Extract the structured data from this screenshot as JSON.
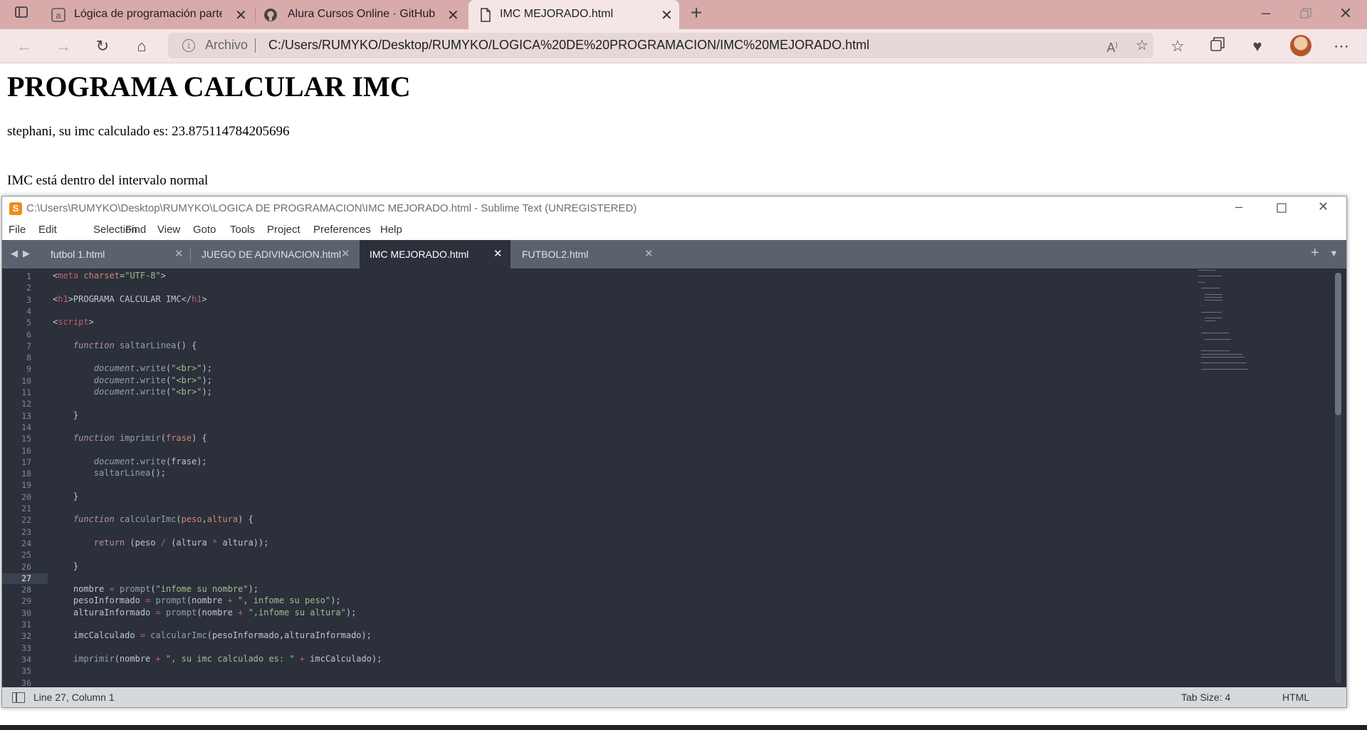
{
  "browser": {
    "tabs": [
      {
        "title": "Lógica de programación parte 2:",
        "icon": "alura-a-icon",
        "active": false
      },
      {
        "title": "Alura Cursos Online · GitHub",
        "icon": "github-icon",
        "active": false
      },
      {
        "title": "IMC MEJORADO.html",
        "icon": "document-icon",
        "active": true
      }
    ],
    "new_tab": "+",
    "omnibox": {
      "scheme_label": "Archivo",
      "url": "C:/Users/RUMYKO/Desktop/RUMYKO/LOGICA%20DE%20PROGRAMACION/IMC%20MEJORADO.html"
    }
  },
  "page": {
    "heading": "PROGRAMA CALCULAR IMC",
    "result_line": "stephani, su imc calculado es: 23.875114784205696",
    "status_line": "IMC está dentro del intervalo normal"
  },
  "sublime": {
    "title": "C:\\Users\\RUMYKO\\Desktop\\RUMYKO\\LOGICA DE PROGRAMACION\\IMC MEJORADO.html - Sublime Text (UNREGISTERED)",
    "menu": [
      "File",
      "Edit",
      "Selection",
      "Find",
      "View",
      "Goto",
      "Tools",
      "Project",
      "Preferences",
      "Help"
    ],
    "tabs": [
      {
        "label": "futbol 1.html",
        "active": false
      },
      {
        "label": "JUEGO DE ADIVINACION.html",
        "active": false
      },
      {
        "label": "IMC MEJORADO.html",
        "active": true
      },
      {
        "label": "FUTBOL2.html",
        "active": false
      }
    ],
    "current_line": 27,
    "line_numbers": [
      "1",
      "2",
      "3",
      "4",
      "5",
      "6",
      "7",
      "8",
      "9",
      "10",
      "11",
      "12",
      "13",
      "14",
      "15",
      "16",
      "17",
      "18",
      "19",
      "20",
      "21",
      "22",
      "23",
      "24",
      "25",
      "26",
      "27",
      "28",
      "29",
      "30",
      "31",
      "32",
      "33",
      "34",
      "35",
      "36"
    ],
    "code": [
      "<meta charset=\"UTF-8\">",
      "",
      "<h1>PROGRAMA CALCULAR IMC</h1>",
      "",
      "<script>",
      "",
      "    function saltarLinea() {",
      "",
      "        document.write(\"<br>\");",
      "        document.write(\"<br>\");",
      "        document.write(\"<br>\");",
      "",
      "    }",
      "",
      "    function imprimir(frase) {",
      "",
      "        document.write(frase);",
      "        saltarLinea();",
      "",
      "    }",
      "",
      "    function calcularImc(peso,altura) {",
      "",
      "        return (peso / (altura * altura));",
      "",
      "    }",
      "",
      "    nombre = prompt(\"infome su nombre\");",
      "    pesoInformado = prompt(nombre + \", infome su peso\");",
      "    alturaInformado = prompt(nombre + \",infome su altura\");",
      "",
      "    imcCalculado = calcularImc(pesoInformado,alturaInformado);",
      "",
      "    imprimir(nombre + \", su imc calculado es: \" + imcCalculado);",
      "",
      ""
    ],
    "status": {
      "position": "Line 27, Column 1",
      "tab_size": "Tab Size: 4",
      "syntax": "HTML"
    }
  },
  "colors": {
    "browser_tabstrip": "#d9aaaa",
    "browser_active_tab": "#f4e6e6",
    "editor_bg": "#2b303b",
    "keyword": "#b48ead",
    "string": "#a3be8c",
    "function": "#8fa1b3",
    "operator": "#bf616a"
  }
}
